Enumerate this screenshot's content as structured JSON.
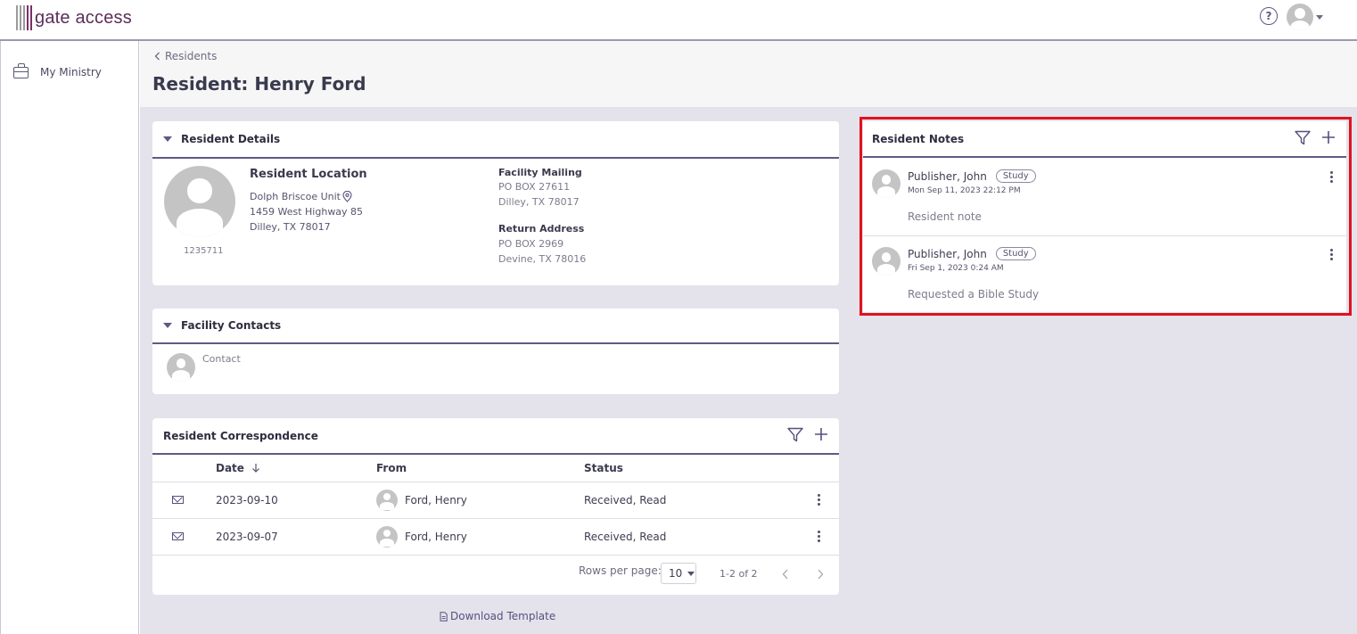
{
  "app": {
    "logo_text": "gate access"
  },
  "header": {
    "help_icon": "question-circle-icon",
    "user_icon": "user-avatar-icon"
  },
  "sidebar": {
    "items": [
      {
        "label": "My Ministry",
        "icon": "briefcase-icon"
      }
    ]
  },
  "page": {
    "breadcrumb": "Residents",
    "title": "Resident: Henry Ford"
  },
  "resident_details": {
    "title": "Resident Details",
    "id": "1235711",
    "location_label": "Resident Location",
    "location_name": "Dolph Briscoe Unit",
    "location_address1": "1459 West Highway 85",
    "location_address2": "Dilley, TX 78017",
    "mailing_label": "Facility Mailing",
    "mailing_line1": "PO BOX 27611",
    "mailing_line2": "Dilley, TX 78017",
    "return_label": "Return Address",
    "return_line1": "PO BOX 2969",
    "return_line2": "Devine, TX 78016"
  },
  "facility_contacts": {
    "title": "Facility Contacts",
    "contact_label": "Contact"
  },
  "correspondence": {
    "title": "Resident Correspondence",
    "columns": {
      "date": "Date",
      "from": "From",
      "status": "Status"
    },
    "rows": [
      {
        "date": "2023-09-10",
        "from": "Ford, Henry",
        "status": "Received, Read"
      },
      {
        "date": "2023-09-07",
        "from": "Ford, Henry",
        "status": "Received, Read"
      }
    ],
    "rows_per_page_label": "Rows per page:",
    "rows_per_page_value": "10",
    "range_label": "1-2 of 2"
  },
  "download_template": "Download Template",
  "notes": {
    "title": "Resident Notes",
    "items": [
      {
        "author": "Publisher, John",
        "tag": "Study",
        "timestamp": "Mon Sep 11, 2023 22:12 PM",
        "text": "Resident note"
      },
      {
        "author": "Publisher, John",
        "tag": "Study",
        "timestamp": "Fri Sep 1, 2023 0:24 AM",
        "text": "Requested a Bible Study"
      }
    ]
  },
  "colors": {
    "accent": "#5f5a84",
    "brand": "#5c2d5a",
    "highlight": "#e3111c",
    "content_bg": "#e4e3ec"
  }
}
